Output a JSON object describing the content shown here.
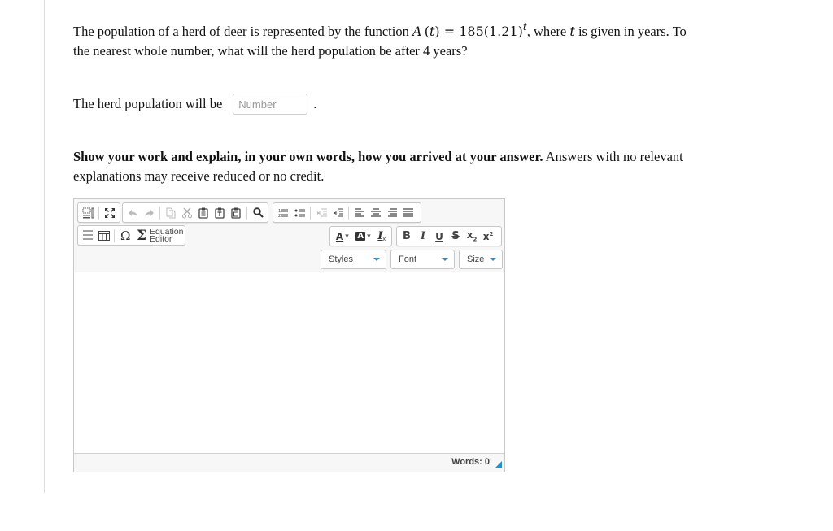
{
  "question": {
    "intro": "The population of a herd of deer is represented by the function ",
    "func_name": "A",
    "func_var": "t",
    "func_rhs": " = 185(1.21)",
    "func_exp": "t",
    "after_func": ", where ",
    "var_t": "t",
    "after_var": " is given in years. To the nearest whole number, what will the herd population be after 4 years?"
  },
  "answer": {
    "label": "The herd population will be",
    "placeholder": "Number",
    "value": "",
    "suffix": "."
  },
  "instructions": {
    "bold": "Show your work and explain, in your own words, how you arrived at your answer.",
    "normal": " Answers with no relevant explanations may receive reduced or no credit."
  },
  "editor": {
    "toolbar_row1": [
      {
        "icon": "show-blocks-icon",
        "title": "Show Blocks"
      },
      {
        "icon": "maximize-icon",
        "title": "Maximize"
      },
      {
        "icon": "undo-icon",
        "title": "Undo",
        "disabled": true
      },
      {
        "icon": "redo-icon",
        "title": "Redo",
        "disabled": true
      },
      {
        "icon": "copy-icon",
        "title": "Copy",
        "disabled": true
      },
      {
        "icon": "cut-icon",
        "title": "Cut",
        "disabled": true
      },
      {
        "icon": "paste-icon",
        "title": "Paste"
      },
      {
        "icon": "paste-text-icon",
        "title": "Paste as plain text"
      },
      {
        "icon": "paste-word-icon",
        "title": "Paste from Word"
      },
      {
        "icon": "find-icon",
        "title": "Find"
      },
      {
        "icon": "numbered-list-icon",
        "title": "Numbered List"
      },
      {
        "icon": "bulleted-list-icon",
        "title": "Bulleted List"
      },
      {
        "icon": "decrease-indent-icon",
        "title": "Decrease Indent",
        "disabled": true
      },
      {
        "icon": "increase-indent-icon",
        "title": "Increase Indent"
      },
      {
        "icon": "align-left-icon",
        "title": "Align Left"
      },
      {
        "icon": "align-center-icon",
        "title": "Center"
      },
      {
        "icon": "align-right-icon",
        "title": "Align Right"
      },
      {
        "icon": "justify-icon",
        "title": "Justify"
      }
    ],
    "toolbar_row2": [
      {
        "icon": "horizontal-line-icon",
        "title": "Horizontal Line"
      },
      {
        "icon": "table-icon",
        "title": "Table"
      },
      {
        "icon": "omega-icon",
        "title": "Special Character",
        "glyph": "Ω"
      },
      {
        "icon": "sigma-icon",
        "title": "Equation",
        "glyph": "Σ"
      }
    ],
    "equation_label_1": "Equation",
    "equation_label_2": "Editor",
    "format_buttons": {
      "text_color": "A",
      "bg_color": "A",
      "remove_format": "I",
      "bold": "B",
      "italic": "I",
      "underline": "U",
      "strike": "S",
      "subscript": "x",
      "superscript": "x"
    },
    "combos": {
      "styles": "Styles",
      "font": "Font",
      "size": "Size"
    },
    "content": "",
    "word_count": "Words: 0",
    "accent_color": "#2b8dc4"
  }
}
